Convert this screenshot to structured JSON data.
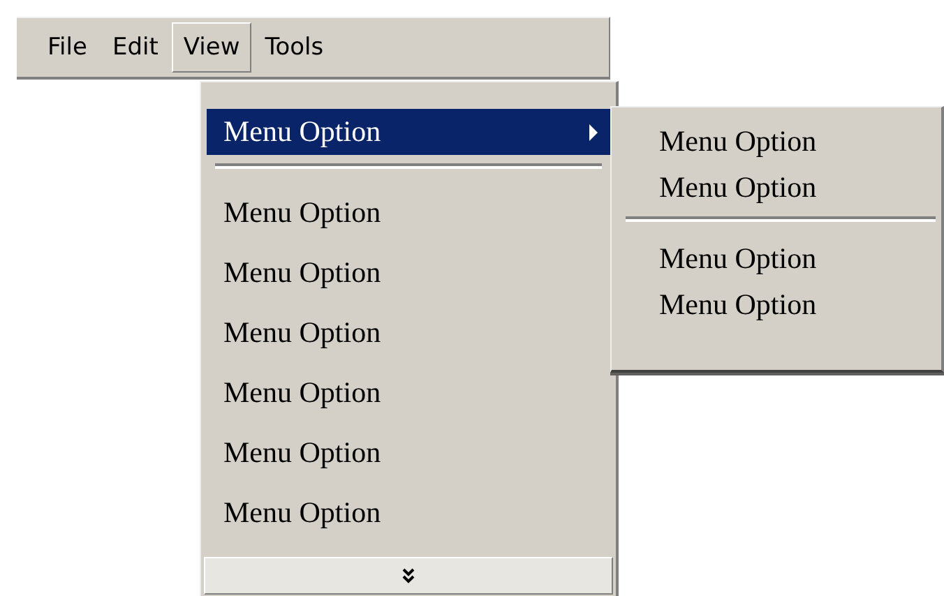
{
  "menubar": [
    {
      "label": "File",
      "selected": false
    },
    {
      "label": "Edit",
      "selected": false
    },
    {
      "label": "View",
      "selected": true
    },
    {
      "label": "Tools",
      "selected": false
    }
  ],
  "menu": {
    "items": [
      {
        "kind": "item",
        "label": "Menu Option",
        "selected": true,
        "has_submenu": true
      },
      {
        "kind": "separator"
      },
      {
        "kind": "item",
        "label": "Menu Option",
        "selected": false,
        "has_submenu": false
      },
      {
        "kind": "item",
        "label": "Menu Option",
        "selected": false,
        "has_submenu": false
      },
      {
        "kind": "item",
        "label": "Menu Option",
        "selected": false,
        "has_submenu": false
      },
      {
        "kind": "item",
        "label": "Menu Option",
        "selected": false,
        "has_submenu": false
      },
      {
        "kind": "item",
        "label": "Menu Option",
        "selected": false,
        "has_submenu": false
      },
      {
        "kind": "item",
        "label": "Menu Option",
        "selected": false,
        "has_submenu": false
      }
    ],
    "more_button": true
  },
  "submenu": {
    "items": [
      {
        "kind": "item",
        "label": "Menu Option"
      },
      {
        "kind": "item",
        "label": "Menu Option"
      },
      {
        "kind": "separator"
      },
      {
        "kind": "item",
        "label": "Menu Option"
      },
      {
        "kind": "item",
        "label": "Menu Option"
      }
    ]
  }
}
